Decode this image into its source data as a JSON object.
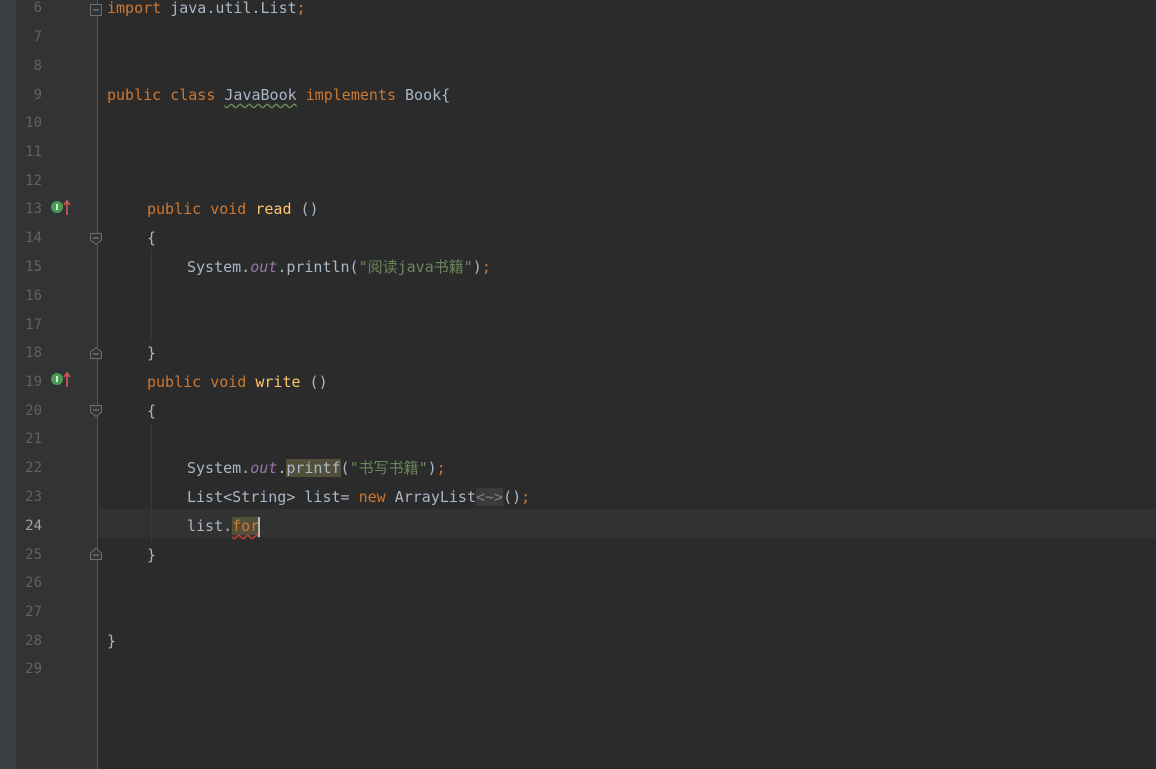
{
  "editor": {
    "language": "java",
    "current_line": "24",
    "line_numbers": [
      "6",
      "7",
      "8",
      "9",
      "10",
      "11",
      "12",
      "13",
      "14",
      "15",
      "16",
      "17",
      "18",
      "19",
      "20",
      "21",
      "22",
      "23",
      "24",
      "25",
      "26",
      "27",
      "28",
      "29"
    ],
    "code": {
      "l6_kw": "import",
      "l6_text": " java.util.List",
      "l6_semi": ";",
      "l9_kw": "public class",
      "l9_classname": "JavaBook",
      "l9_kw2": "implements",
      "l9_rest": " Book{",
      "l13_kw": "public void",
      "l13_fn": "read",
      "l13_rest": " ()",
      "l14_brace": "{",
      "l15_sys": "System.",
      "l15_field": "out",
      "l15_call": ".println(",
      "l15_str": "\"阅读java书籍\"",
      "l15_close": ")",
      "l15_semi": ";",
      "l18_brace": "}",
      "l19_kw": "public void",
      "l19_fn": "write",
      "l19_rest": " ()",
      "l20_brace": "{",
      "l22_sys": "System.",
      "l22_field": "out",
      "l22_dot": ".",
      "l22_call": "printf",
      "l22_paren": "(",
      "l22_str": "\"书写书籍\"",
      "l22_close": ")",
      "l22_semi": ";",
      "l23_type": "List<String> list= ",
      "l23_kw": "new",
      "l23_class": " ArrayList",
      "l23_diamond": "<~>",
      "l23_close": "()",
      "l23_semi": ";",
      "l24_obj": "list.",
      "l24_typed": "for",
      "l25_brace": "}",
      "l28_brace": "}"
    },
    "gutter_icons": {
      "line13": "implements-method-icon",
      "line19": "implements-method-icon"
    },
    "colors": {
      "background": "#2b2b2b",
      "keyword": "#cc7832",
      "method": "#ffc66d",
      "string": "#6a8759",
      "field": "#9876aa",
      "text": "#a9b7c6",
      "line_number": "#606366"
    }
  }
}
